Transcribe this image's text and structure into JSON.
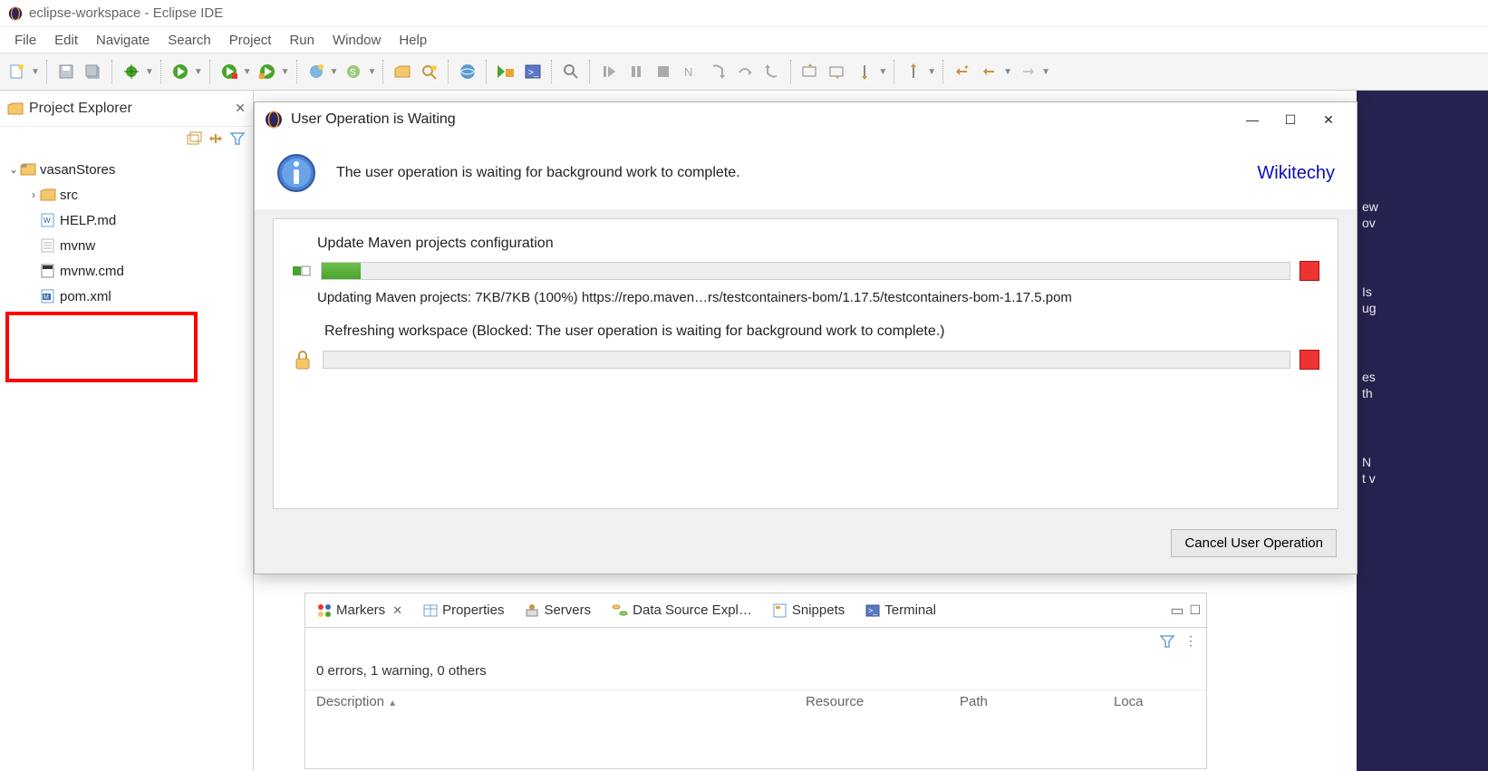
{
  "window": {
    "title": "eclipse-workspace - Eclipse IDE"
  },
  "menus": [
    "File",
    "Edit",
    "Navigate",
    "Search",
    "Project",
    "Run",
    "Window",
    "Help"
  ],
  "explorer": {
    "title": "Project Explorer",
    "project": "vasanStores",
    "nodes": {
      "src": "src",
      "help": "HELP.md",
      "mvnw": "mvnw",
      "mvnwcmd": "mvnw.cmd",
      "pom": "pom.xml"
    }
  },
  "dialog": {
    "title": "User Operation is Waiting",
    "message": "The user operation is waiting for background work to complete.",
    "brand": "Wikitechy",
    "task1": {
      "title": "Update Maven projects configuration",
      "detail": "Updating Maven projects: 7KB/7KB (100%) https://repo.maven…rs/testcontainers-bom/1.17.5/testcontainers-bom-1.17.5.pom",
      "percent": 4
    },
    "task2": {
      "title": "Refreshing workspace (Blocked: The user operation is waiting for background work to complete.)"
    },
    "cancel": "Cancel User Operation"
  },
  "bottom": {
    "tabs": [
      "Markers",
      "Properties",
      "Servers",
      "Data Source Expl…",
      "Snippets",
      "Terminal"
    ],
    "summary": "0 errors, 1 warning, 0 others",
    "cols": [
      "Description",
      "Resource",
      "Path",
      "Loca"
    ]
  },
  "right_fragments": [
    "ew",
    "ov",
    "Is",
    "ug",
    "es",
    "th",
    "N",
    "t v"
  ]
}
